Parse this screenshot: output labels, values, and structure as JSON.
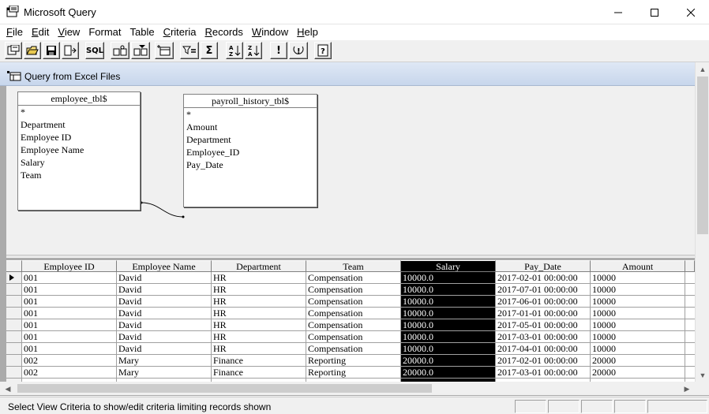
{
  "window": {
    "title": "Microsoft Query",
    "icon": "microsoft-query-icon"
  },
  "menu": [
    {
      "label": "File",
      "accel": "F",
      "rest": "ile"
    },
    {
      "label": "Edit",
      "accel": "E",
      "rest": "dit"
    },
    {
      "label": "View",
      "accel": "V",
      "rest": "iew"
    },
    {
      "label": "Format",
      "accel": "",
      "rest": "Format"
    },
    {
      "label": "Table",
      "accel": "",
      "rest": "Table"
    },
    {
      "label": "Criteria",
      "accel": "C",
      "rest": "riteria"
    },
    {
      "label": "Records",
      "accel": "R",
      "rest": "ecords"
    },
    {
      "label": "Window",
      "accel": "W",
      "rest": "indow"
    },
    {
      "label": "Help",
      "accel": "H",
      "rest": "elp"
    }
  ],
  "toolbar": {
    "sql_label": "SQL",
    "sum_label": "Σ",
    "exclaim_label": "!",
    "help_label": "?"
  },
  "child_window": {
    "title": "Query from Excel Files"
  },
  "tables": [
    {
      "name": "employee_tbl$",
      "fields": [
        "*",
        "Department",
        "Employee ID",
        "Employee Name",
        "Salary",
        "Team"
      ]
    },
    {
      "name": "payroll_history_tbl$",
      "fields": [
        "*",
        "Amount",
        "Department",
        "Employee_ID",
        "Pay_Date"
      ]
    }
  ],
  "grid": {
    "columns": [
      "Employee ID",
      "Employee Name",
      "Department",
      "Team",
      "Salary",
      "Pay_Date",
      "Amount"
    ],
    "selected_column": "Salary",
    "rows": [
      [
        "001",
        "David",
        "HR",
        "Compensation",
        "10000.0",
        "2017-02-01 00:00:00",
        "10000"
      ],
      [
        "001",
        "David",
        "HR",
        "Compensation",
        "10000.0",
        "2017-07-01 00:00:00",
        "10000"
      ],
      [
        "001",
        "David",
        "HR",
        "Compensation",
        "10000.0",
        "2017-06-01 00:00:00",
        "10000"
      ],
      [
        "001",
        "David",
        "HR",
        "Compensation",
        "10000.0",
        "2017-01-01 00:00:00",
        "10000"
      ],
      [
        "001",
        "David",
        "HR",
        "Compensation",
        "10000.0",
        "2017-05-01 00:00:00",
        "10000"
      ],
      [
        "001",
        "David",
        "HR",
        "Compensation",
        "10000.0",
        "2017-03-01 00:00:00",
        "10000"
      ],
      [
        "001",
        "David",
        "HR",
        "Compensation",
        "10000.0",
        "2017-04-01 00:00:00",
        "10000"
      ],
      [
        "002",
        "Mary",
        "Finance",
        "Reporting",
        "20000.0",
        "2017-02-01 00:00:00",
        "20000"
      ],
      [
        "002",
        "Mary",
        "Finance",
        "Reporting",
        "20000.0",
        "2017-03-01 00:00:00",
        "20000"
      ]
    ]
  },
  "status": {
    "text": "Select View Criteria to show/edit criteria limiting records shown"
  },
  "colors": {
    "selection": "#000000",
    "child_title_gradient": "#c7d6ec"
  }
}
